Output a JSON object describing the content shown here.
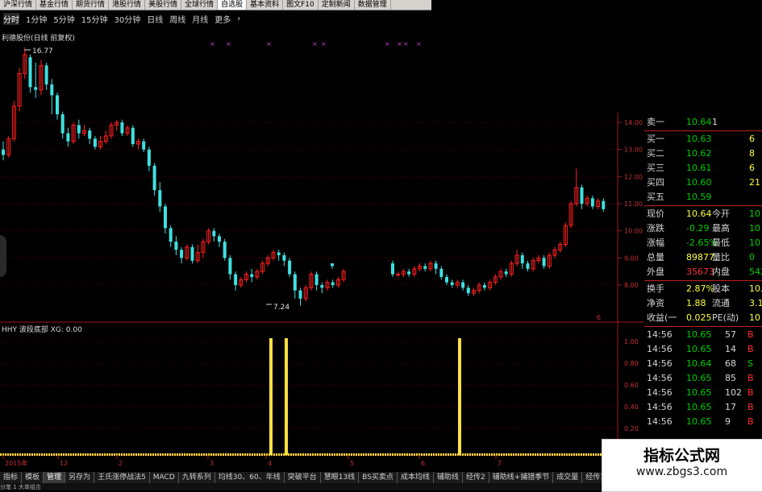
{
  "top_tabs": [
    "沪深行情",
    "基金行情",
    "期货行情",
    "港股行情",
    "美股行情",
    "全球行情",
    "自选股",
    "基本资料",
    "图文F10",
    "定制新闻",
    "数据管理"
  ],
  "period_tabs": [
    "分时",
    "1分钟",
    "5分钟",
    "15分钟",
    "30分钟",
    "日线",
    "周线",
    "月线",
    "更多"
  ],
  "period_more_arrow": "›",
  "chart_title": "利德股份(日线 前复权)",
  "high_label": "16.77",
  "low_label": "7.24",
  "indicator_title": "HHY 波段底部 XG: 0.00",
  "colors": {
    "up": "#ff2020",
    "down": "#40e0e0",
    "axis": "#a01818",
    "signal": "#ffe040",
    "grid": "#5a0000"
  },
  "icons": [
    "toolbar-left-knob-icon"
  ],
  "chart_data": {
    "type": "candlestick",
    "title": "利德股份(日线 前复权)",
    "price_ylim": [
      7.0,
      14.5
    ],
    "price_ticks": [
      "14.00",
      "13.00",
      "12.00",
      "11.00",
      "10.00",
      "9.00",
      "8.00"
    ],
    "indicator_ticks": [
      "1.00",
      "0.80",
      "0.60",
      "0.40",
      "0.20"
    ],
    "x_ticks": [
      "2015年",
      "12",
      "2",
      "3",
      "4",
      "5",
      "6",
      "7"
    ],
    "extra_tick": "6",
    "candles": [
      [
        13.0,
        12.8,
        13.3,
        12.6
      ],
      [
        12.8,
        13.4,
        13.5,
        12.7
      ],
      [
        13.4,
        14.6,
        14.8,
        13.3
      ],
      [
        14.6,
        15.8,
        16.0,
        14.4
      ],
      [
        15.8,
        16.5,
        16.77,
        15.6
      ],
      [
        16.4,
        15.3,
        16.5,
        15.1
      ],
      [
        15.3,
        15.2,
        16.2,
        14.9
      ],
      [
        15.2,
        16.1,
        16.3,
        15.0
      ],
      [
        16.1,
        15.4,
        16.2,
        15.2
      ],
      [
        15.4,
        15.0,
        15.6,
        14.3
      ],
      [
        15.0,
        14.3,
        15.1,
        14.1
      ],
      [
        14.3,
        13.6,
        14.4,
        13.4
      ],
      [
        13.6,
        13.3,
        13.8,
        13.1
      ],
      [
        13.3,
        13.9,
        14.0,
        13.2
      ],
      [
        13.9,
        13.6,
        14.1,
        13.4
      ],
      [
        13.6,
        13.7,
        13.9,
        13.5
      ],
      [
        13.7,
        13.4,
        13.8,
        13.2
      ],
      [
        13.4,
        13.1,
        13.5,
        13.0
      ],
      [
        13.1,
        13.3,
        13.5,
        13.0
      ],
      [
        13.3,
        13.5,
        13.7,
        13.2
      ],
      [
        13.5,
        13.9,
        14.0,
        13.4
      ],
      [
        13.9,
        14.0,
        14.1,
        13.7
      ],
      [
        14.0,
        13.6,
        14.1,
        13.5
      ],
      [
        13.6,
        13.8,
        13.9,
        13.5
      ],
      [
        13.8,
        13.2,
        13.9,
        13.1
      ],
      [
        13.2,
        13.3,
        13.4,
        13.0
      ],
      [
        13.3,
        13.0,
        13.4,
        12.9
      ],
      [
        13.0,
        12.4,
        13.1,
        12.2
      ],
      [
        12.4,
        11.5,
        12.5,
        11.3
      ],
      [
        11.5,
        10.9,
        11.8,
        10.7
      ],
      [
        10.9,
        10.1,
        11.0,
        9.9
      ],
      [
        10.1,
        9.6,
        10.2,
        9.4
      ],
      [
        9.6,
        9.3,
        9.8,
        9.1
      ],
      [
        9.3,
        9.0,
        9.4,
        8.8
      ],
      [
        9.0,
        9.4,
        9.5,
        8.9
      ],
      [
        9.4,
        8.9,
        9.5,
        8.8
      ],
      [
        8.9,
        9.2,
        9.5,
        8.8
      ],
      [
        9.2,
        9.6,
        9.7,
        9.0
      ],
      [
        9.6,
        10.0,
        10.1,
        9.5
      ],
      [
        10.0,
        9.8,
        10.1,
        9.6
      ],
      [
        9.8,
        9.6,
        9.9,
        9.4
      ],
      [
        9.6,
        9.0,
        9.7,
        8.9
      ],
      [
        9.0,
        8.4,
        9.1,
        8.2
      ],
      [
        8.4,
        8.0,
        8.5,
        7.8
      ],
      [
        8.0,
        8.2,
        8.3,
        7.9
      ],
      [
        8.2,
        8.4,
        8.5,
        8.1
      ],
      [
        8.4,
        8.3,
        8.6,
        8.1
      ],
      [
        8.3,
        8.5,
        8.6,
        8.2
      ],
      [
        8.5,
        8.8,
        8.9,
        8.4
      ],
      [
        8.8,
        9.0,
        9.1,
        8.7
      ],
      [
        9.0,
        9.2,
        9.3,
        8.9
      ],
      [
        9.2,
        9.1,
        9.3,
        8.9
      ],
      [
        9.1,
        8.9,
        9.2,
        8.7
      ],
      [
        8.9,
        8.4,
        9.0,
        8.3
      ],
      [
        8.4,
        7.8,
        8.5,
        7.5
      ],
      [
        7.8,
        7.5,
        7.9,
        7.24
      ],
      [
        7.5,
        7.9,
        8.0,
        7.4
      ],
      [
        7.9,
        8.4,
        8.5,
        7.8
      ],
      [
        8.4,
        8.0,
        8.5,
        7.8
      ],
      [
        8.0,
        7.9,
        8.1,
        7.7
      ],
      [
        7.9,
        8.1,
        8.2,
        7.8
      ],
      [
        8.1,
        8.0,
        8.2,
        7.9
      ],
      [
        8.0,
        8.2,
        8.3,
        7.9
      ],
      [
        8.2,
        8.5,
        8.6,
        8.1
      ]
    ],
    "candles_gap1": [
      [
        8.8,
        8.7,
        8.8,
        8.6
      ]
    ],
    "candles_right": [
      [
        8.8,
        8.4,
        8.9,
        8.3
      ],
      [
        8.4,
        8.4,
        8.5,
        8.3
      ],
      [
        8.4,
        8.5,
        8.6,
        8.3
      ],
      [
        8.5,
        8.4,
        8.6,
        8.3
      ],
      [
        8.4,
        8.6,
        8.7,
        8.3
      ],
      [
        8.6,
        8.7,
        8.8,
        8.5
      ],
      [
        8.7,
        8.6,
        8.8,
        8.5
      ],
      [
        8.6,
        8.8,
        8.9,
        8.5
      ],
      [
        8.8,
        8.6,
        8.9,
        8.4
      ],
      [
        8.6,
        8.3,
        8.7,
        8.2
      ],
      [
        8.3,
        8.1,
        8.4,
        8.0
      ],
      [
        8.1,
        8.0,
        8.2,
        7.9
      ],
      [
        8.0,
        8.1,
        8.2,
        7.9
      ],
      [
        8.1,
        7.9,
        8.2,
        7.8
      ],
      [
        7.9,
        7.7,
        8.0,
        7.6
      ],
      [
        7.7,
        7.8,
        7.9,
        7.6
      ],
      [
        7.8,
        8.0,
        8.1,
        7.7
      ],
      [
        8.0,
        7.9,
        8.1,
        7.8
      ],
      [
        7.9,
        8.1,
        8.2,
        7.8
      ],
      [
        8.1,
        8.3,
        8.4,
        8.0
      ],
      [
        8.3,
        8.5,
        8.6,
        8.2
      ],
      [
        8.5,
        8.4,
        8.6,
        8.3
      ],
      [
        8.4,
        8.8,
        8.9,
        8.3
      ],
      [
        8.8,
        9.1,
        9.3,
        8.7
      ],
      [
        9.1,
        8.8,
        9.2,
        8.6
      ],
      [
        8.8,
        8.6,
        8.9,
        8.5
      ],
      [
        8.6,
        8.9,
        9.0,
        8.5
      ],
      [
        8.9,
        9.0,
        9.1,
        8.8
      ],
      [
        9.0,
        8.7,
        9.1,
        8.6
      ],
      [
        8.7,
        9.1,
        9.2,
        8.6
      ],
      [
        9.1,
        9.3,
        9.4,
        9.0
      ],
      [
        9.3,
        9.5,
        9.6,
        9.2
      ],
      [
        9.5,
        10.2,
        10.3,
        9.4
      ],
      [
        10.2,
        11.0,
        11.1,
        10.1
      ],
      [
        11.0,
        11.6,
        12.3,
        10.9
      ],
      [
        11.6,
        11.0,
        11.7,
        10.8
      ],
      [
        11.0,
        11.2,
        11.3,
        10.9
      ],
      [
        11.2,
        10.9,
        11.3,
        10.8
      ],
      [
        10.9,
        11.1,
        11.2,
        10.8
      ],
      [
        11.1,
        10.8,
        11.2,
        10.7
      ]
    ],
    "signals": [
      {
        "x": 336,
        "v": 1.0
      },
      {
        "x": 355,
        "v": 1.0
      },
      {
        "x": 570,
        "v": 1.0
      }
    ]
  },
  "quote_panel": {
    "asks": [
      {
        "label": "卖一",
        "price": "10.64",
        "vol": "1"
      }
    ],
    "bids": [
      {
        "label": "买一",
        "price": "10.63",
        "vol": "6"
      },
      {
        "label": "买二",
        "price": "10.62",
        "vol": "8"
      },
      {
        "label": "买三",
        "price": "10.61",
        "vol": "6"
      },
      {
        "label": "买四",
        "price": "10.60",
        "vol": "21"
      },
      {
        "label": "买五",
        "price": "10.59",
        "vol": ""
      }
    ],
    "stats": [
      {
        "k1": "现价",
        "v1": "10.64",
        "k2": "今开",
        "v2": "10"
      },
      {
        "k1": "涨跌",
        "v1": "-0.29",
        "k2": "最高",
        "v2": "10"
      },
      {
        "k1": "涨幅",
        "v1": "-2.65%",
        "k2": "最低",
        "v2": "10"
      },
      {
        "k1": "总量",
        "v1": "89877",
        "k2": "量比",
        "v2": "0"
      },
      {
        "k1": "外盘",
        "v1": "35673",
        "k2": "内盘",
        "v2": "542"
      }
    ],
    "stats2": [
      {
        "k1": "换手",
        "v1": "2.87%",
        "k2": "股本",
        "v2": "10."
      },
      {
        "k1": "净资",
        "v1": "1.88",
        "k2": "流通",
        "v2": "3.1"
      },
      {
        "k1": "收益(一",
        "v1": "0.025",
        "k2": "PE(动)",
        "v2": "10"
      }
    ],
    "ticks": [
      {
        "t": "14:56",
        "p": "10.65",
        "v": "57",
        "s": "B"
      },
      {
        "t": "14:56",
        "p": "10.65",
        "v": "14",
        "s": "B"
      },
      {
        "t": "14:56",
        "p": "10.64",
        "v": "68",
        "s": "S"
      },
      {
        "t": "14:56",
        "p": "10.65",
        "v": "85",
        "s": "B"
      },
      {
        "t": "14:56",
        "p": "10.65",
        "v": "102",
        "s": "B"
      },
      {
        "t": "14:56",
        "p": "10.65",
        "v": "17",
        "s": "B"
      },
      {
        "t": "14:56",
        "p": "10.65",
        "v": "9",
        "s": "B"
      }
    ]
  },
  "bottom_tabs": [
    "指标",
    "模板",
    "管理",
    "另存为",
    "王氏涨停战法5",
    "MACD",
    "九转系列",
    "均线30、60、年线",
    "突破平台",
    "慧眼13线",
    "BS买卖点",
    "成本均线",
    "辅助线",
    "经传2",
    "辅助线+捕猎季节",
    "成交量",
    "经传1"
  ],
  "status_text": "分笔 1  大单组合",
  "watermark": {
    "line1": "指标公式网",
    "line2": "www.zbgs3.com"
  }
}
